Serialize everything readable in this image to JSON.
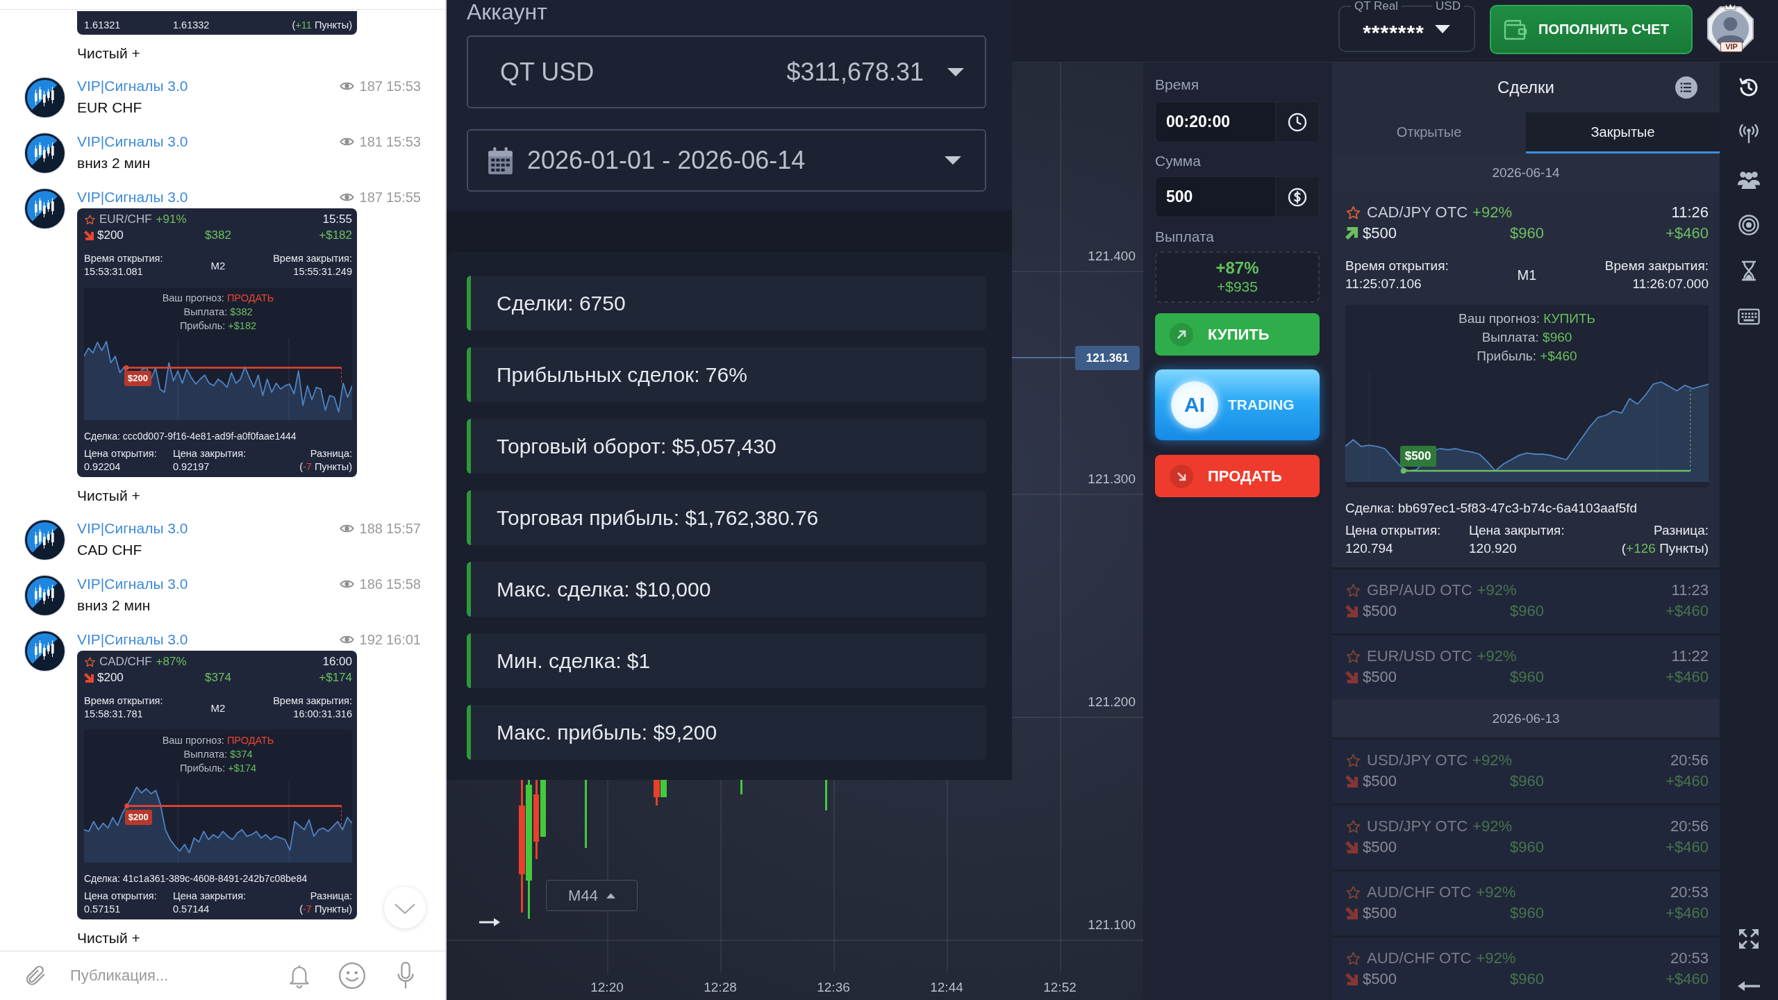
{
  "chat": {
    "messages": [
      {
        "kind": "card_tail",
        "open_price": "1.61321",
        "close_price": "1.61332",
        "difference": {
          "before": "(",
          "value": "+11",
          "after": "Пункты)"
        },
        "rising": true,
        "caption": "Чистый +"
      },
      {
        "kind": "text",
        "author": "VIP|Сигналы 3.0",
        "views": "187",
        "time": "15:53",
        "text": "EUR CHF"
      },
      {
        "kind": "text",
        "author": "VIP|Сигналы 3.0",
        "views": "181",
        "time": "15:53",
        "text": "вниз 2 мин"
      },
      {
        "kind": "card",
        "author": "VIP|Сигналы 3.0",
        "views": "187",
        "time": "15:55",
        "card": {
          "kind": "down",
          "asset": "EUR/CHF",
          "payout": "+91%",
          "time": "15:55",
          "amount": "$200",
          "payout_amount": "$382",
          "profit": "+$182",
          "details": {
            "open_label": "Время открытия:",
            "open_time": "15:53:31.081",
            "timeframe": "M2",
            "close_label": "Время закрытия:",
            "close_time": "15:55:31.249",
            "forecast": {
              "label": "Ваш прогноз:",
              "value": "ПРОДАТЬ"
            },
            "payout_line": {
              "label": "Выплата:",
              "value": "$382"
            },
            "profit_line": {
              "label": "Прибыль:",
              "value": "+$182"
            },
            "strike_tag": "$200",
            "deal": "Сделка: ccc0d007-9f16-4e81-ad9f-a0f0faae1444",
            "open_price_label": "Цена открытия:",
            "open_price": "0.92204",
            "close_price_label": "Цена закрытия:",
            "close_price": "0.92197",
            "difference_label": "Разница:",
            "difference": {
              "before": "(",
              "value": "-7",
              "after": "Пункты)"
            },
            "rising": false
          }
        },
        "caption": "Чистый +"
      },
      {
        "kind": "text",
        "author": "VIP|Сигналы 3.0",
        "views": "188",
        "time": "15:57",
        "text": "CAD CHF"
      },
      {
        "kind": "text",
        "author": "VIP|Сигналы 3.0",
        "views": "186",
        "time": "15:58",
        "text": "вниз 2 мин"
      },
      {
        "kind": "card",
        "author": "VIP|Сигналы 3.0",
        "views": "192",
        "time": "16:01",
        "card": {
          "kind": "down",
          "asset": "CAD/CHF",
          "payout": "+87%",
          "time": "16:00",
          "amount": "$200",
          "payout_amount": "$374",
          "profit": "+$174",
          "details": {
            "open_label": "Время открытия:",
            "open_time": "15:58:31.781",
            "timeframe": "M2",
            "close_label": "Время закрытия:",
            "close_time": "16:00:31.316",
            "forecast": {
              "label": "Ваш прогноз:",
              "value": "ПРОДАТЬ"
            },
            "payout_line": {
              "label": "Выплата:",
              "value": "$374"
            },
            "profit_line": {
              "label": "Прибыль:",
              "value": "+$174"
            },
            "strike_tag": "$200",
            "deal": "Сделка: 41c1a361-389c-4608-8491-242b7c08be84",
            "open_price_label": "Цена открытия:",
            "open_price": "0.57151",
            "close_price_label": "Цена закрытия:",
            "close_price": "0.57144",
            "difference_label": "Разница:",
            "difference": {
              "before": "(",
              "value": "-7",
              "after": "Пункты)"
            },
            "rising": false
          }
        },
        "caption": "Чистый +"
      }
    ],
    "composer": {
      "placeholder": "Публикация..."
    }
  },
  "account_panel": {
    "title": "Аккаунт",
    "account": {
      "name": "QT USD",
      "balance": "$311,678.31"
    },
    "date_range": "2026-01-01 - 2026-06-14",
    "stats": [
      "Сделки: 6750",
      "Прибыльных сделок: 76%",
      "Торговый оборот: $5,057,430",
      "Торговая прибыль: $1,762,380.76",
      "Макс. сделка: $10,000",
      "Мин. сделка: $1",
      "Макс. прибыль: $9,200"
    ]
  },
  "chart": {
    "price_labels": [
      "121.400",
      "121.300",
      "121.200",
      "121.100"
    ],
    "current_price": "121.361",
    "time_labels": [
      "12:20",
      "12:28",
      "12:36",
      "12:44",
      "12:52"
    ],
    "timeframe": "M44"
  },
  "top_bar": {
    "account_type": "QT Real",
    "currency": "USD",
    "balance_masked": "*******",
    "deposit_button": "ПОПОЛНИТЬ СЧЕТ",
    "avatar_badge": "VIP"
  },
  "trade_form": {
    "time_label": "Время",
    "time_value": "00:20:00",
    "amount_label": "Сумма",
    "amount_value": "500",
    "payout_label": "Выплата",
    "payout_percent": "+87%",
    "payout_amount": "+$935",
    "buy_button": "КУПИТЬ",
    "ai_button": {
      "badge": "AI",
      "label": "TRADING"
    },
    "sell_button": "ПРОДАТЬ"
  },
  "trades_panel": {
    "title": "Сделки",
    "tabs": [
      {
        "label": "Открытые",
        "selected": false
      },
      {
        "label": "Закрытые",
        "selected": true
      }
    ],
    "groups": [
      {
        "date": "2026-06-14",
        "trades": [
          {
            "kind": "up",
            "expanded": true,
            "asset": "CAD/JPY OTC",
            "payout": "+92%",
            "time": "11:26",
            "amount": "$500",
            "payout_amount": "$960",
            "profit": "+$460",
            "details": {
              "open_label": "Время открытия:",
              "open_time": "11:25:07.106",
              "timeframe": "M1",
              "close_label": "Время закрытия:",
              "close_time": "11:26:07.000",
              "forecast": {
                "label": "Ваш прогноз:",
                "value": "КУПИТЬ"
              },
              "payout_line": {
                "label": "Выплата:",
                "value": "$960"
              },
              "profit_line": {
                "label": "Прибыль:",
                "value": "+$460"
              },
              "strike_tag": "$500",
              "deal": "Сделка: bb697ec1-5f83-47c3-b74c-6a4103aaf5fd",
              "open_price_label": "Цена открытия:",
              "open_price": "120.794",
              "close_price_label": "Цена закрытия:",
              "close_price": "120.920",
              "difference_label": "Разница:",
              "difference": {
                "before": "(",
                "value": "+126",
                "after": "Пункты)"
              },
              "rising": true
            }
          },
          {
            "kind": "down",
            "expanded": false,
            "asset": "GBP/AUD OTC",
            "payout": "+92%",
            "time": "11:23",
            "amount": "$500",
            "payout_amount": "$960",
            "profit": "+$460"
          },
          {
            "kind": "down",
            "expanded": false,
            "asset": "EUR/USD OTC",
            "payout": "+92%",
            "time": "11:22",
            "amount": "$500",
            "payout_amount": "$960",
            "profit": "+$460"
          }
        ]
      },
      {
        "date": "2026-06-13",
        "trades": [
          {
            "kind": "down",
            "expanded": false,
            "asset": "USD/JPY OTC",
            "payout": "+92%",
            "time": "20:56",
            "amount": "$500",
            "payout_amount": "$960",
            "profit": "+$460"
          },
          {
            "kind": "down",
            "expanded": false,
            "asset": "USD/JPY OTC",
            "payout": "+92%",
            "time": "20:56",
            "amount": "$500",
            "payout_amount": "$960",
            "profit": "+$460"
          },
          {
            "kind": "down",
            "expanded": false,
            "asset": "AUD/CHF OTC",
            "payout": "+92%",
            "time": "20:53",
            "amount": "$500",
            "payout_amount": "$960",
            "profit": "+$460"
          },
          {
            "kind": "down",
            "expanded": false,
            "asset": "AUD/CHF OTC",
            "payout": "+92%",
            "time": "20:53",
            "amount": "$500",
            "payout_amount": "$960",
            "profit": "+$460"
          }
        ]
      }
    ]
  }
}
